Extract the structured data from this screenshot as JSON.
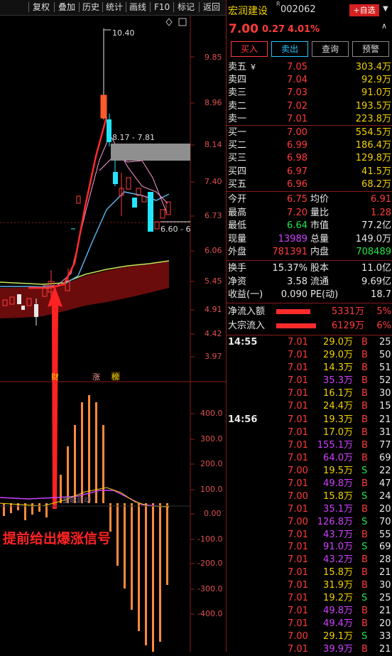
{
  "toolbar": {
    "items": [
      "复权",
      "叠加",
      "历史",
      "统计",
      "画线",
      "F10",
      "标记",
      "返回"
    ]
  },
  "stock": {
    "name": "宏润建设",
    "code": "002062",
    "name_marker": "R",
    "add_watch_label": "+自选",
    "price": "7.00",
    "change": "0.27",
    "change_pct": "4.01%"
  },
  "actions": [
    "买入",
    "卖出",
    "查询",
    "预警"
  ],
  "asks": [
    {
      "label": "卖五",
      "price": "7.05",
      "vol": "303.4万"
    },
    {
      "label": "卖四",
      "price": "7.04",
      "vol": "92.9万"
    },
    {
      "label": "卖三",
      "price": "7.03",
      "vol": "91.0万"
    },
    {
      "label": "卖二",
      "price": "7.02",
      "vol": "193.5万"
    },
    {
      "label": "卖一",
      "price": "7.01",
      "vol": "223.8万"
    }
  ],
  "ask_currency_mark": "¥",
  "bids": [
    {
      "label": "买一",
      "price": "7.00",
      "vol": "554.5万"
    },
    {
      "label": "买二",
      "price": "6.99",
      "vol": "186.4万"
    },
    {
      "label": "买三",
      "price": "6.98",
      "vol": "129.8万"
    },
    {
      "label": "买四",
      "price": "6.97",
      "vol": "41.5万"
    },
    {
      "label": "买五",
      "price": "6.96",
      "vol": "68.2万"
    }
  ],
  "stats": [
    {
      "l1": "今开",
      "v1": "6.75",
      "c1": "red",
      "l2": "均价",
      "v2": "6.91",
      "c2": "red"
    },
    {
      "l1": "最高",
      "v1": "7.20",
      "c1": "red",
      "l2": "量比",
      "v2": "1.28",
      "c2": "red"
    },
    {
      "l1": "最低",
      "v1": "6.64",
      "c1": "green",
      "l2": "市值",
      "v2": "77.2亿",
      "c2": "white"
    },
    {
      "l1": "现量",
      "v1": "13989",
      "c1": "purple",
      "l2": "总量",
      "v2": "149.0万",
      "c2": "white"
    },
    {
      "l1": "外盘",
      "v1": "781391",
      "c1": "red",
      "l2": "内盘",
      "v2": "708489",
      "c2": "green"
    }
  ],
  "stats2": [
    {
      "l1": "换手",
      "v1": "15.37%",
      "l2": "股本",
      "v2": "11.0亿"
    },
    {
      "l1": "净资",
      "v1": "3.58",
      "l2": "流通",
      "v2": "9.69亿"
    },
    {
      "l1": "收益(一)",
      "v1": "0.090",
      "l2": "PE(动)",
      "v2": "18.7"
    }
  ],
  "flows": [
    {
      "label": "净流入额",
      "value": "5331万",
      "pct": "5%"
    },
    {
      "label": "大宗流入",
      "value": "6129万",
      "pct": "6%"
    }
  ],
  "ticks": [
    {
      "time": "14:55",
      "price": "7.01",
      "vol": "29.0万",
      "vc": "yellow",
      "side": "B",
      "n": "25"
    },
    {
      "time": "",
      "price": "7.01",
      "vol": "29.0万",
      "vc": "yellow",
      "side": "B",
      "n": "50"
    },
    {
      "time": "",
      "price": "7.01",
      "vol": "14.3万",
      "vc": "yellow",
      "side": "B",
      "n": "51"
    },
    {
      "time": "",
      "price": "7.01",
      "vol": "35.3万",
      "vc": "purple",
      "side": "B",
      "n": "52"
    },
    {
      "time": "",
      "price": "7.01",
      "vol": "16.1万",
      "vc": "yellow",
      "side": "B",
      "n": "30"
    },
    {
      "time": "",
      "price": "7.01",
      "vol": "24.4万",
      "vc": "yellow",
      "side": "B",
      "n": "15"
    },
    {
      "time": "14:56",
      "price": "7.01",
      "vol": "19.3万",
      "vc": "yellow",
      "side": "B",
      "n": "21"
    },
    {
      "time": "",
      "price": "7.01",
      "vol": "17.0万",
      "vc": "yellow",
      "side": "B",
      "n": "31"
    },
    {
      "time": "",
      "price": "7.01",
      "vol": "155.1万",
      "vc": "purple",
      "side": "B",
      "n": "77"
    },
    {
      "time": "",
      "price": "7.01",
      "vol": "64.0万",
      "vc": "purple",
      "side": "B",
      "n": "69"
    },
    {
      "time": "",
      "price": "7.00",
      "vol": "19.5万",
      "vc": "yellow",
      "side": "S",
      "n": "22"
    },
    {
      "time": "",
      "price": "7.01",
      "vol": "49.8万",
      "vc": "purple",
      "side": "B",
      "n": "47"
    },
    {
      "time": "",
      "price": "7.00",
      "vol": "15.8万",
      "vc": "yellow",
      "side": "S",
      "n": "24"
    },
    {
      "time": "",
      "price": "7.01",
      "vol": "35.1万",
      "vc": "purple",
      "side": "B",
      "n": "20"
    },
    {
      "time": "",
      "price": "7.00",
      "vol": "126.8万",
      "vc": "purple",
      "side": "S",
      "n": "70"
    },
    {
      "time": "",
      "price": "7.01",
      "vol": "43.7万",
      "vc": "purple",
      "side": "B",
      "n": "55"
    },
    {
      "time": "",
      "price": "7.01",
      "vol": "91.0万",
      "vc": "purple",
      "side": "S",
      "n": "69"
    },
    {
      "time": "",
      "price": "7.01",
      "vol": "43.2万",
      "vc": "purple",
      "side": "B",
      "n": "28"
    },
    {
      "time": "",
      "price": "7.01",
      "vol": "15.8万",
      "vc": "yellow",
      "side": "B",
      "n": "21"
    },
    {
      "time": "",
      "price": "7.01",
      "vol": "31.9万",
      "vc": "yellow",
      "side": "B",
      "n": "30"
    },
    {
      "time": "",
      "price": "7.01",
      "vol": "19.2万",
      "vc": "yellow",
      "side": "S",
      "n": "25"
    },
    {
      "time": "",
      "price": "7.01",
      "vol": "49.8万",
      "vc": "purple",
      "side": "B",
      "n": "21"
    },
    {
      "time": "",
      "price": "7.01",
      "vol": "49.4万",
      "vc": "purple",
      "side": "B",
      "n": "20"
    },
    {
      "time": "",
      "price": "7.00",
      "vol": "29.1万",
      "vc": "yellow",
      "side": "S",
      "n": "33"
    },
    {
      "time": "",
      "price": "7.01",
      "vol": "39.9万",
      "vc": "purple",
      "side": "B",
      "n": "21"
    }
  ],
  "chart": {
    "price_ticks": [
      "9.85",
      "8.96",
      "8.14",
      "7.40",
      "6.73",
      "6.06",
      "5.45",
      "4.91",
      "4.42",
      "3.97"
    ],
    "indicator_ticks": [
      "400.0",
      "300.0",
      "200.0",
      "100.0",
      "0.00",
      "-100.0",
      "-200.0",
      "-300.0",
      "-400.0"
    ],
    "high_label": "10.40",
    "range_label_1": "8.17 - 7.81",
    "range_label_2": "6.60 - 6",
    "markers": [
      "财",
      "涨",
      "榜"
    ],
    "annotation": "提前给出爆涨信号",
    "faint_label": "量能启动"
  }
}
